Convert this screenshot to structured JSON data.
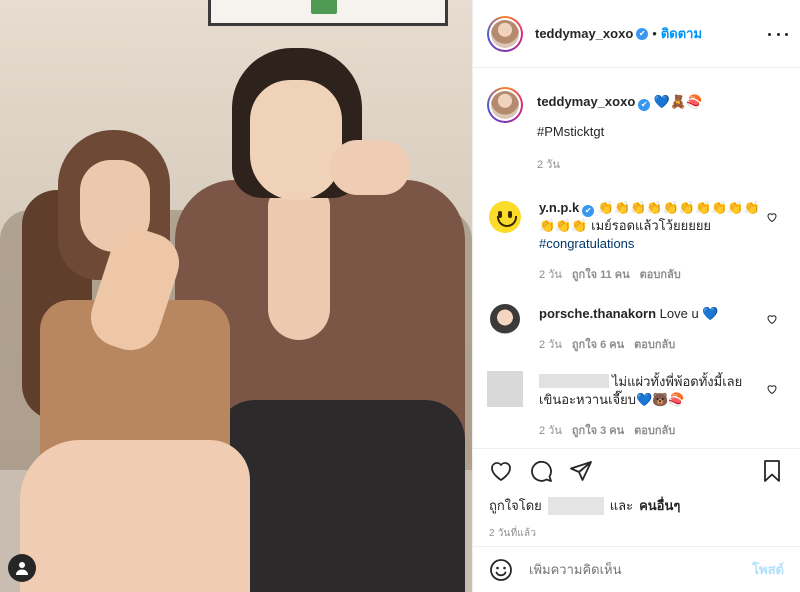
{
  "post": {
    "username": "teddymay_xoxo",
    "follow_label": "ติดตาม",
    "caption_emojis": "💙🧸🍣",
    "caption_hashtag": "#PMsticktgt",
    "caption_time": "2 วัน"
  },
  "comments": [
    {
      "username": "y.n.p.k",
      "text_line1": "👏👏👏👏👏👏👏👏👏👏",
      "text_line2": "👏👏👏 เมย์รอดแล้วโว้ยยยยย",
      "hashtag": "#congratulations",
      "time": "2 วัน",
      "likes": "ถูกใจ 11 คน",
      "reply": "ตอบกลับ"
    },
    {
      "username": "porsche.thanakorn",
      "text": "Love u 💙",
      "time": "2 วัน",
      "likes": "ถูกใจ 6 คน",
      "reply": "ตอบกลับ"
    },
    {
      "text_line1": "ไม่แผ่วทั้งพี่พ้อดทั้งมี้เลย",
      "text_line2": "เขินอะหวานเจี๊ยบ💙🐻🍣",
      "time": "2 วัน",
      "likes": "ถูกใจ 3 คน",
      "reply": "ตอบกลับ"
    }
  ],
  "actions": {
    "liked_by_prefix": "ถูกใจโดย",
    "liked_by_and": "และ",
    "liked_by_others": "คนอื่นๆ",
    "posted_time": "2 วันที่แล้ว"
  },
  "add_comment": {
    "placeholder": "เพิ่มความคิดเห็น",
    "post_label": "โพสต์"
  },
  "colors": {
    "link_blue": "#0095f6",
    "verified": "#3897f0",
    "hashtag": "#00376b",
    "muted": "#8e8e8e"
  }
}
